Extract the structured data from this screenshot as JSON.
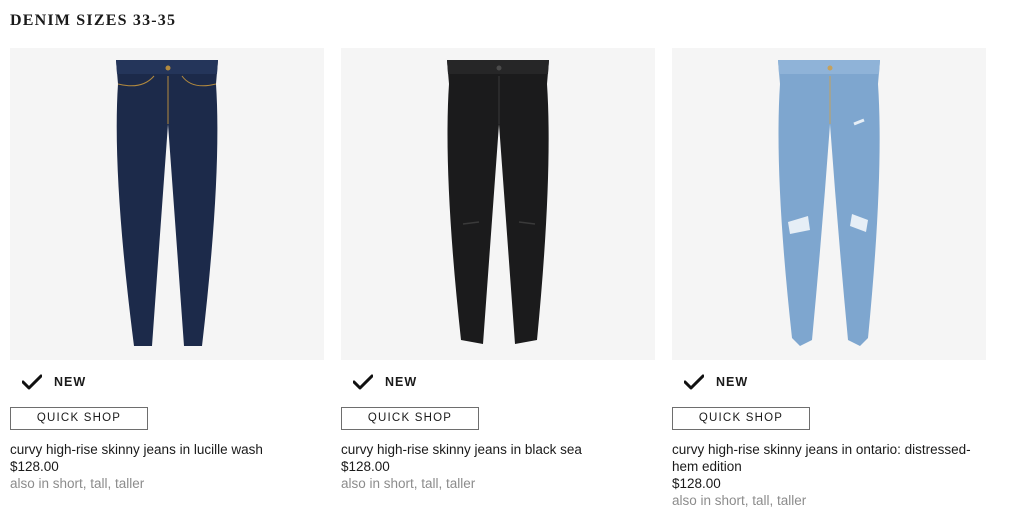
{
  "section": {
    "title": "DENIM SIZES 33-35"
  },
  "products": [
    {
      "name": "curvy high-rise skinny jeans in lucille wash",
      "price": "$128.00",
      "badge": "NEW",
      "quick_shop": "QUICK SHOP",
      "also": "also in short, tall, taller",
      "wash_color": "#1c2a4a",
      "image_icon": "dark-rinse-jeans"
    },
    {
      "name": "curvy high-rise skinny jeans in black sea",
      "price": "$128.00",
      "badge": "NEW",
      "quick_shop": "QUICK SHOP",
      "also": "also in short, tall, taller",
      "wash_color": "#1b1b1c",
      "image_icon": "black-jeans"
    },
    {
      "name": "curvy high-rise skinny jeans in ontario: distressed-hem edition",
      "price": "$128.00",
      "badge": "NEW",
      "quick_shop": "QUICK SHOP",
      "also": "also in short, tall, taller",
      "wash_color": "#7ea6cf",
      "image_icon": "light-wash-distressed-jeans"
    }
  ],
  "icons": {
    "badge_icon": "checkmark-icon"
  }
}
